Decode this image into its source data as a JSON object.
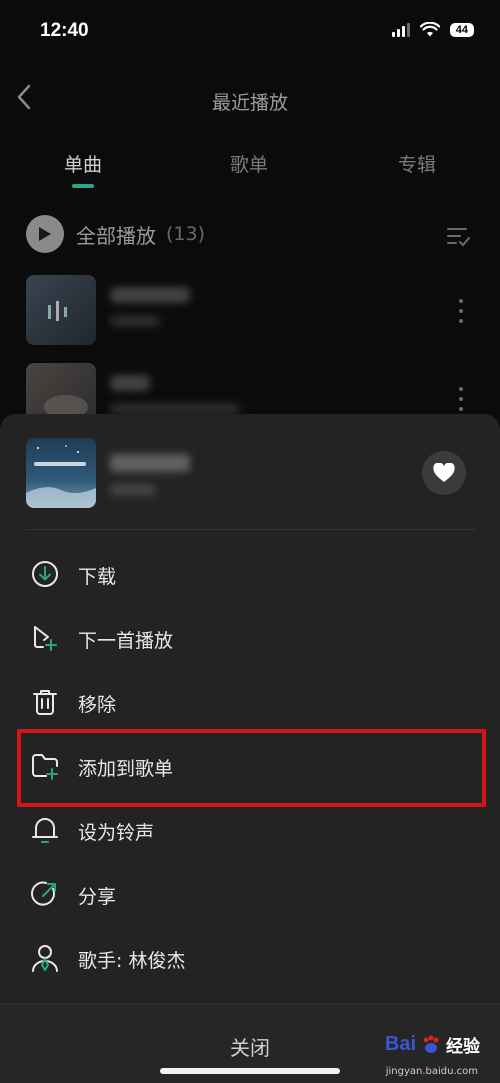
{
  "status_bar": {
    "time": "12:40",
    "battery": "44"
  },
  "header": {
    "title": "最近播放"
  },
  "tabs": [
    {
      "label": "单曲",
      "active": true
    },
    {
      "label": "歌单",
      "active": false
    },
    {
      "label": "专辑",
      "active": false
    }
  ],
  "play_all": {
    "label": "全部播放",
    "count": "(13)"
  },
  "sheet": {
    "menu_items": [
      {
        "label": "下载",
        "icon": "download-icon"
      },
      {
        "label": "下一首播放",
        "icon": "play-next-icon"
      },
      {
        "label": "移除",
        "icon": "trash-icon"
      },
      {
        "label": "添加到歌单",
        "icon": "add-to-playlist-icon"
      },
      {
        "label": "设为铃声",
        "icon": "bell-icon"
      },
      {
        "label": "分享",
        "icon": "share-icon"
      },
      {
        "label": "歌手: 林俊杰",
        "icon": "artist-icon"
      }
    ],
    "close_label": "关闭"
  },
  "colors": {
    "accent": "#2aa58a",
    "highlight": "#d1151a"
  },
  "watermark": {
    "brand": "Bai",
    "brand2": "经验",
    "domain": "jingyan.baidu.com"
  }
}
